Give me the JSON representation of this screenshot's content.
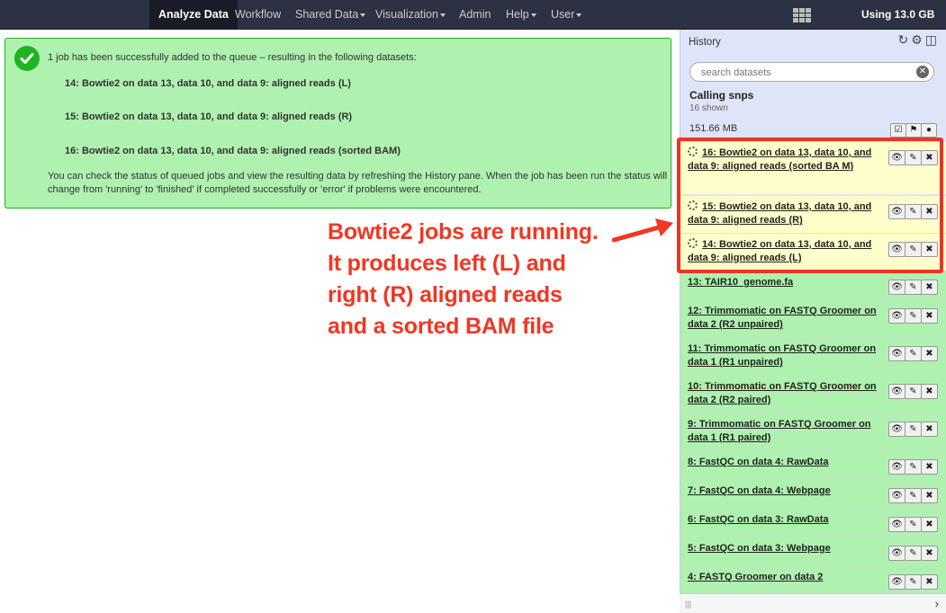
{
  "masthead": {
    "nav": [
      {
        "label": "Analyze Data",
        "active": true,
        "dropdown": false
      },
      {
        "label": "Workflow",
        "active": false,
        "dropdown": false
      },
      {
        "label": "Shared Data",
        "active": false,
        "dropdown": true
      },
      {
        "label": "Visualization",
        "active": false,
        "dropdown": true
      },
      {
        "label": "Admin",
        "active": false,
        "dropdown": false
      },
      {
        "label": "Help",
        "active": false,
        "dropdown": true
      },
      {
        "label": "User",
        "active": false,
        "dropdown": true
      }
    ],
    "quota": "Using 13.0 GB",
    "apps_icon": "grid-icon"
  },
  "message": {
    "intro": "1 job has been successfully added to the queue – resulting in the following datasets:",
    "datasets": [
      "14: Bowtie2 on data 13, data 10, and data 9: aligned reads (L)",
      "15: Bowtie2 on data 13, data 10, and data 9: aligned reads (R)",
      "16: Bowtie2 on data 13, data 10, and data 9: aligned reads (sorted BAM)"
    ],
    "note": "You can check the status of queued jobs and view the resulting data by refreshing the History pane. When the job has been run the status will change from 'running' to 'finished' if completed successfully or 'error' if problems were encountered.",
    "status_color": "#20b420"
  },
  "annotation": {
    "lines": [
      "Bowtie2 jobs are running.",
      "It produces left (L) and",
      "right (R) aligned reads",
      "and a sorted BAM file"
    ],
    "color": "#f13622"
  },
  "history": {
    "title": "History",
    "search_placeholder": "search datasets",
    "name": "Calling snps",
    "shown": "16 shown",
    "size": "151.66 MB",
    "datasets": [
      {
        "title": "16: Bowtie2 on data 13, data 10, and data 9: aligned reads (sorted BA M)",
        "state": "running"
      },
      {
        "title": "15: Bowtie2 on data 13, data 10, and data 9: aligned reads (R)",
        "state": "running"
      },
      {
        "title": "14: Bowtie2 on data 13, data 10, and data 9: aligned reads (L)",
        "state": "running"
      },
      {
        "title": "13: TAIR10_genome.fa",
        "state": "ok"
      },
      {
        "title": "12: Trimmomatic on FASTQ Groomer on data 2 (R2 unpaired)",
        "state": "ok"
      },
      {
        "title": "11: Trimmomatic on FASTQ Groomer on data 1 (R1 unpaired)",
        "state": "ok"
      },
      {
        "title": "10: Trimmomatic on FASTQ Groomer on data 2 (R2 paired)",
        "state": "ok"
      },
      {
        "title": "9: Trimmomatic on FASTQ Groomer on data 1 (R1 paired)",
        "state": "ok"
      },
      {
        "title": "8: FastQC on data 4: RawData",
        "state": "ok"
      },
      {
        "title": "7: FastQC on data 4: Webpage",
        "state": "ok"
      },
      {
        "title": "6: FastQC on data 3: RawData",
        "state": "ok"
      },
      {
        "title": "5: FastQC on data 3: Webpage",
        "state": "ok"
      },
      {
        "title": "4: FASTQ Groomer on data 2",
        "state": "ok"
      }
    ]
  }
}
